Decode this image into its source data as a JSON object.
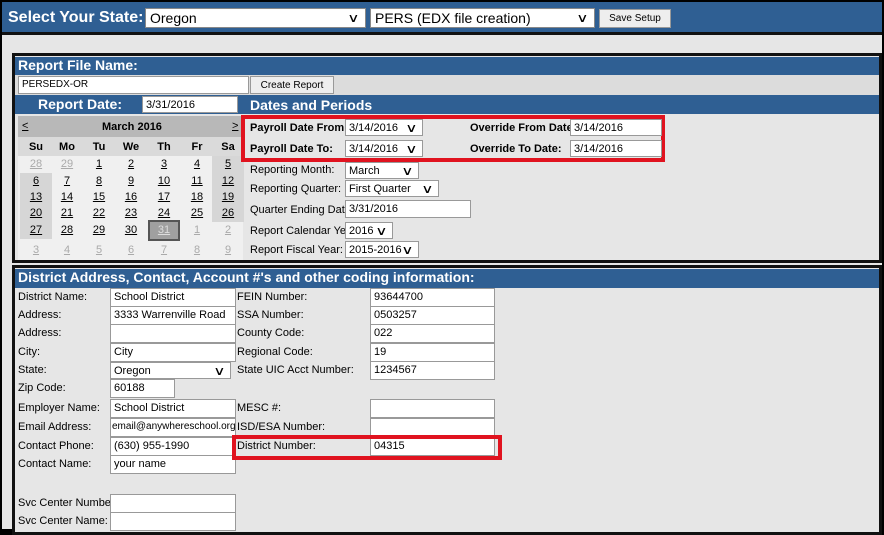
{
  "topbar": {
    "state_label": "Select Your State:",
    "state_value": "Oregon",
    "report_value": "PERS (EDX file creation)",
    "save_setup": "Save Setup"
  },
  "report": {
    "file_name_label": "Report File Name:",
    "file_name_value": "PERSEDX-OR",
    "create_report": "Create Report",
    "report_date_label": "Report Date:",
    "report_date_value": "3/31/2016",
    "dates_periods": "Dates and Periods"
  },
  "calendar": {
    "prev": "<",
    "next": ">",
    "month": "March 2016",
    "day_names": [
      "Su",
      "Mo",
      "Tu",
      "We",
      "Th",
      "Fr",
      "Sa"
    ],
    "weeks": [
      [
        "28",
        "29",
        "1",
        "2",
        "3",
        "4",
        "5"
      ],
      [
        "6",
        "7",
        "8",
        "9",
        "10",
        "11",
        "12"
      ],
      [
        "13",
        "14",
        "15",
        "16",
        "17",
        "18",
        "19"
      ],
      [
        "20",
        "21",
        "22",
        "23",
        "24",
        "25",
        "26"
      ],
      [
        "27",
        "28",
        "29",
        "30",
        "31",
        "1",
        "2"
      ],
      [
        "3",
        "4",
        "5",
        "6",
        "7",
        "8",
        "9"
      ]
    ],
    "selected": "31"
  },
  "dates": {
    "payroll_from_label": "Payroll Date From:",
    "payroll_from": "3/14/2016",
    "payroll_to_label": "Payroll Date To:",
    "payroll_to": "3/14/2016",
    "override_from_label": "Override From Date:",
    "override_from": "3/14/2016",
    "override_to_label": "Override To Date:",
    "override_to": "3/14/2016",
    "month_label": "Reporting Month:",
    "month": "March",
    "quarter_label": "Reporting Quarter:",
    "quarter": "First Quarter",
    "qend_label": "Quarter Ending Date:",
    "qend": "3/31/2016",
    "cal_year_label": "Report Calendar Year:",
    "cal_year": "2016",
    "fiscal_label": "Report Fiscal Year:",
    "fiscal": "2015-2016"
  },
  "district": {
    "header": "District Address, Contact, Account #'s and other coding information:",
    "left": [
      {
        "label": "District Name:",
        "value": "School District"
      },
      {
        "label": "Address:",
        "value": "3333 Warrenville Road"
      },
      {
        "label": "Address:",
        "value": ""
      },
      {
        "label": "City:",
        "value": "City"
      },
      {
        "label": "State:",
        "value": "Oregon"
      },
      {
        "label": "Zip Code:",
        "value": "60188"
      },
      {
        "label": "Employer Name:",
        "value": "School District"
      },
      {
        "label": "Email Address:",
        "value": "email@anywhereschool.org"
      },
      {
        "label": "Contact Phone:",
        "value": "(630) 955-1990"
      },
      {
        "label": "Contact Name:",
        "value": "your name"
      },
      {
        "label": "Svc Center Number:",
        "value": ""
      },
      {
        "label": "Svc Center Name:",
        "value": ""
      }
    ],
    "right": [
      {
        "label": "FEIN Number:",
        "value": "93644700"
      },
      {
        "label": "SSA Number:",
        "value": "0503257"
      },
      {
        "label": "County Code:",
        "value": "022"
      },
      {
        "label": "Regional Code:",
        "value": "19"
      },
      {
        "label": "State UIC Acct Number:",
        "value": "1234567"
      },
      {
        "label": "MESC #:",
        "value": ""
      },
      {
        "label": "ISD/ESA Number:",
        "value": ""
      },
      {
        "label": "District Number:",
        "value": "04315"
      }
    ]
  },
  "colors": {
    "header_blue": "#2f5f93",
    "highlight_red": "#e0131f"
  }
}
